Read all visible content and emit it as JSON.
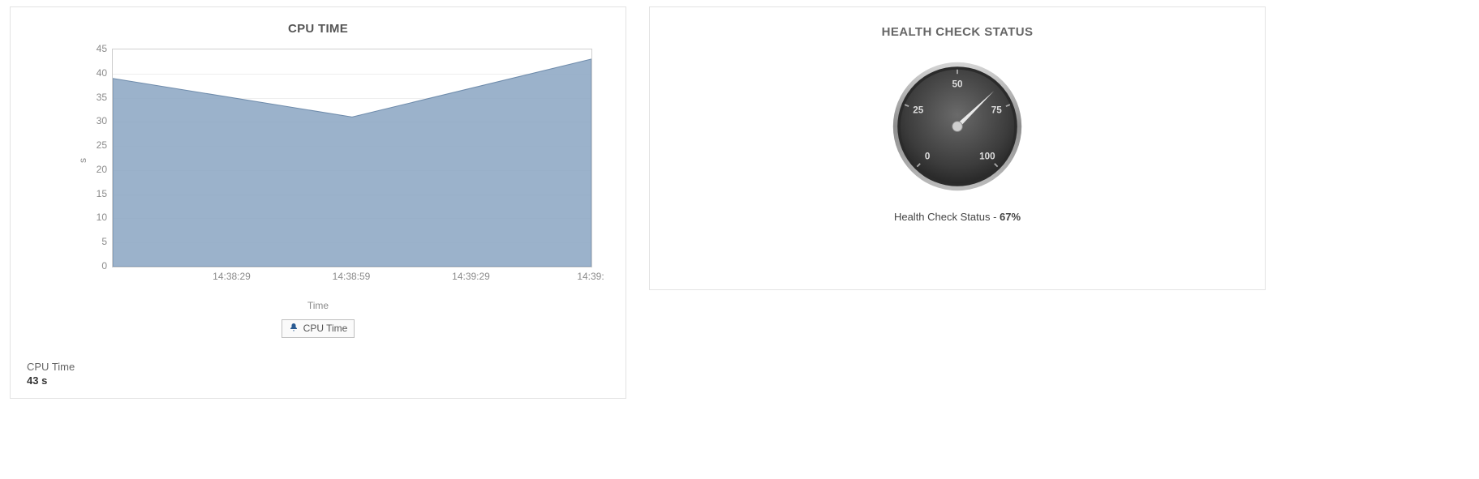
{
  "left": {
    "title": "CPU TIME",
    "ylabel": "s",
    "xlabel": "Time",
    "legend": "CPU Time",
    "summary_label": "CPU Time",
    "summary_value": "43 s"
  },
  "right": {
    "title": "HEALTH CHECK STATUS",
    "caption_prefix": "Health Check Status - ",
    "caption_value": "67%",
    "gauge_ticks": {
      "g0": "0",
      "g25": "25",
      "g50": "50",
      "g75": "75",
      "g100": "100"
    }
  },
  "chart_data": [
    {
      "type": "area",
      "title": "CPU TIME",
      "xlabel": "Time",
      "ylabel": "s",
      "ylim": [
        0,
        45
      ],
      "yticks": [
        0,
        5,
        10,
        15,
        20,
        25,
        30,
        35,
        40,
        45
      ],
      "x_tick_labels": [
        "14:38:29",
        "14:38:59",
        "14:39:29",
        "14:39:"
      ],
      "series": [
        {
          "name": "CPU Time",
          "x": [
            "14:37:59",
            "14:38:59",
            "14:39:59"
          ],
          "values": [
            39,
            31,
            43
          ]
        }
      ],
      "legend": [
        "CPU Time"
      ],
      "fill_color": "#8aa4c2"
    },
    {
      "type": "gauge",
      "title": "HEALTH CHECK STATUS",
      "range": [
        0,
        100
      ],
      "ticks": [
        0,
        25,
        50,
        75,
        100
      ],
      "value": 67,
      "caption": "Health Check Status - 67%"
    }
  ]
}
